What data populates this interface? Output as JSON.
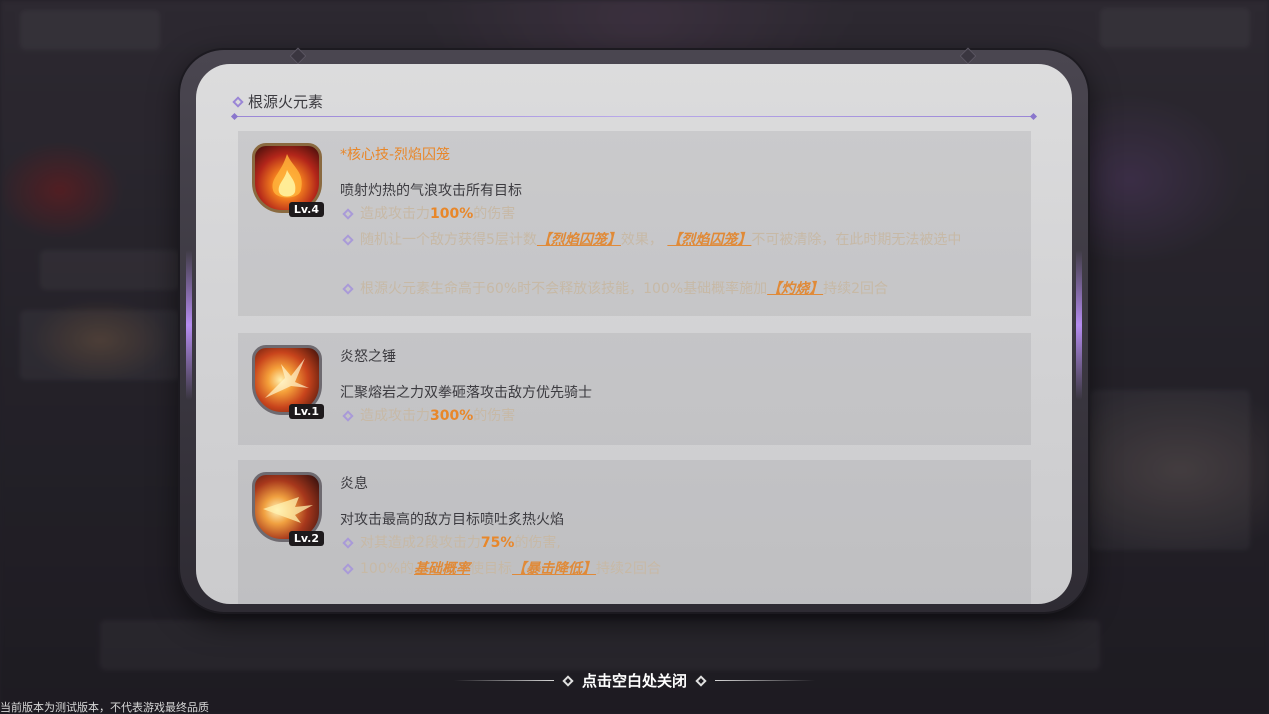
{
  "panel": {
    "title": "根源火元素"
  },
  "skills": [
    {
      "name": "*核心技-烈焰囚笼",
      "level": "Lv.4",
      "desc": "喷射灼热的气浪攻击所有目标",
      "effects": {
        "e1_pre": "造成攻击力",
        "e1_hl": "100%",
        "e1_post": "的伤害",
        "e2_pre": "随机让一个敌方获得5层计数",
        "e2_tag1": "【烈焰囚笼】",
        "e2_mid": "效果，",
        "e2_tag2": "【烈焰囚笼】",
        "e2_post": "不可被清除，在此时期无法被选中",
        "e3_pre": "根源火元素生命高于60%时不会释放该技能，100%基础概率施加",
        "e3_tag": "【灼烧】",
        "e3_post": "持续2回合"
      }
    },
    {
      "name": "炎怒之锤",
      "level": "Lv.1",
      "desc": "汇聚熔岩之力双拳砸落攻击敌方优先骑士",
      "effects": {
        "e1_pre": "造成攻击力",
        "e1_hl": "300%",
        "e1_post": "的伤害"
      }
    },
    {
      "name": "炎息",
      "level": "Lv.2",
      "desc": "对攻击最高的敌方目标喷吐炙热火焰",
      "effects": {
        "e1_pre": "对其造成2段攻击力",
        "e1_hl": "75%",
        "e1_post": "的伤害,",
        "e2_pre": "100%的",
        "e2_tag1": "基础概率",
        "e2_mid": "使目标",
        "e2_tag2": "【暴击降低】",
        "e2_post": "持续2回合"
      }
    }
  ],
  "close_hint": "点击空白处关闭",
  "footer_note": "当前版本为测试版本，不代表游戏最终品质"
}
